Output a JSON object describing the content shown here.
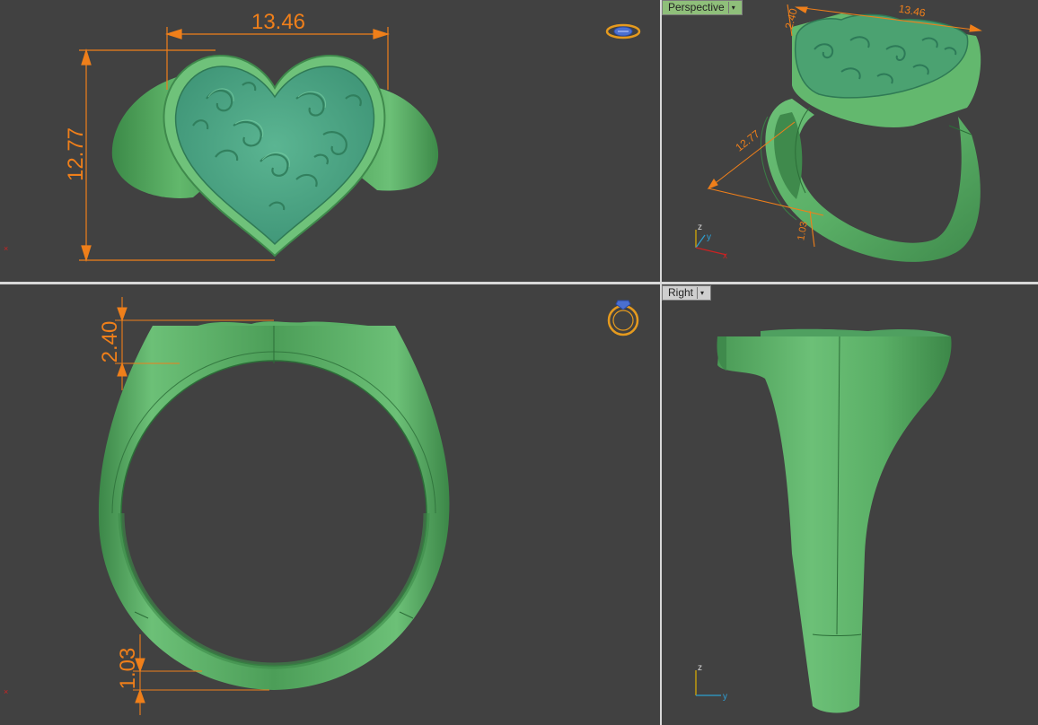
{
  "viewports": {
    "top": {
      "dim_width": "13.46",
      "dim_height": "12.77"
    },
    "perspective": {
      "label": "Perspective",
      "dim_width": "13.46",
      "dim_depth": "2.40",
      "dim_length": "12.77",
      "dim_band": "1.03",
      "axis_z": "z",
      "axis_y": "y",
      "axis_x": "x"
    },
    "front": {
      "dim_top": "2.40",
      "dim_bottom": "1.03"
    },
    "right": {
      "label": "Right",
      "axis_z": "z",
      "axis_y": "y"
    }
  },
  "colors": {
    "background": "#414141",
    "ring_green": "#5fb56a",
    "ring_dark": "#3f8a4c",
    "heart_teal": "#4fa88a",
    "dimension_orange": "#ef7f1a",
    "active_label": "#8fbf7a"
  },
  "icons": {
    "top_view_icon": "ring-top-icon",
    "front_view_icon": "ring-front-icon"
  }
}
